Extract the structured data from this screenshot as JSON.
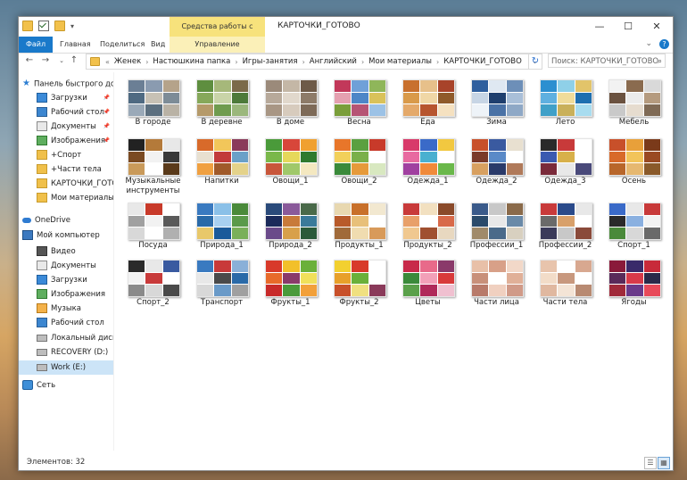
{
  "window": {
    "title": "КАРТОЧКИ_ГОТОВО",
    "picture_tools_tab": "Средства работы с рисунками",
    "controls": {
      "minimize": "—",
      "maximize": "☐",
      "close": "✕"
    }
  },
  "ribbon": {
    "tabs": [
      "Файл",
      "Главная",
      "Поделиться",
      "Вид"
    ],
    "manage_tab": "Управление",
    "collapse_icon": "⌄",
    "help_icon": "?"
  },
  "address": {
    "prefix": "«",
    "segments": [
      "Женек",
      "Настюшкина папка",
      "Игры-занятия",
      "Английский",
      "Мои материалы",
      "КАРТОЧКИ_ГОТОВО"
    ],
    "dropdown": "⌄",
    "refresh": "↻",
    "search_placeholder": "Поиск: КАРТОЧКИ_ГОТОВО",
    "search_icon": "⌕"
  },
  "sidebar": {
    "items": [
      {
        "label": "Панель быстрого доступа",
        "icon": "star-icon"
      },
      {
        "label": "Загрузки",
        "icon": "downloads-icon",
        "pinned": true
      },
      {
        "label": "Рабочий стол",
        "icon": "desktop-icon",
        "pinned": true
      },
      {
        "label": "Документы",
        "icon": "documents-icon",
        "pinned": true
      },
      {
        "label": "Изображения",
        "icon": "pictures-icon",
        "pinned": true
      },
      {
        "label": "+Спорт",
        "icon": "folder-icon"
      },
      {
        "label": "+Части тела",
        "icon": "folder-icon"
      },
      {
        "label": "КАРТОЧКИ_ГОТОВО",
        "icon": "folder-icon"
      },
      {
        "label": "Мои материалы",
        "icon": "folder-icon"
      },
      {
        "label": "OneDrive",
        "icon": "onedrive-icon"
      },
      {
        "label": "Мой компьютер",
        "icon": "computer-icon"
      },
      {
        "label": "Видео",
        "icon": "video-icon"
      },
      {
        "label": "Документы",
        "icon": "documents-icon"
      },
      {
        "label": "Загрузки",
        "icon": "downloads-icon"
      },
      {
        "label": "Изображения",
        "icon": "pictures-icon"
      },
      {
        "label": "Музыка",
        "icon": "music-icon"
      },
      {
        "label": "Рабочий стол",
        "icon": "desktop-icon"
      },
      {
        "label": "Локальный диск (C:)",
        "icon": "drive-icon"
      },
      {
        "label": "RECOVERY (D:)",
        "icon": "drive-icon"
      },
      {
        "label": "Work (E:)",
        "icon": "drive-icon",
        "selected": true
      },
      {
        "label": "Сеть",
        "icon": "network-icon"
      }
    ]
  },
  "folders": [
    {
      "name": "В городе",
      "colors": [
        "#6b7f95",
        "#8a9bb0",
        "#b5a38a",
        "#4f6a82",
        "#c7c1b5",
        "#7d8c97",
        "#9aa9b8",
        "#5c6f7f",
        "#b9b2a5"
      ]
    },
    {
      "name": "В деревне",
      "colors": [
        "#5e8e3f",
        "#a6b87a",
        "#7b6a4a",
        "#86a85a",
        "#c9d4a8",
        "#4d7a3a",
        "#b59a6a",
        "#6f9b4e",
        "#9bb77c"
      ]
    },
    {
      "name": "В доме",
      "colors": [
        "#9b8a7a",
        "#c4b7a6",
        "#6d5a48",
        "#b7a99a",
        "#e1d8cc",
        "#8d7b69",
        "#a89684",
        "#d7cbbd",
        "#7d6a58"
      ]
    },
    {
      "name": "Весна",
      "colors": [
        "#c2385a",
        "#6fa0d8",
        "#8fb65a",
        "#e5a0b0",
        "#4d86c7",
        "#d9c25a",
        "#7a9e3a",
        "#b65474",
        "#9cc2e6"
      ]
    },
    {
      "name": "Еда",
      "colors": [
        "#c8702e",
        "#e7c08a",
        "#a8432a",
        "#d99a4a",
        "#f0d7a6",
        "#8f5a2a",
        "#e4a96a",
        "#b7552f",
        "#f5e1c0"
      ]
    },
    {
      "name": "Зима",
      "colors": [
        "#2f5f9e",
        "#dfe8f2",
        "#6d8fb8",
        "#c7d5e5",
        "#1f3f6e",
        "#a9bfd8",
        "#eef3f8",
        "#4a72a6",
        "#8ea8c6"
      ]
    },
    {
      "name": "Лето",
      "colors": [
        "#2c8fd0",
        "#8fd0e8",
        "#e2c46a",
        "#5fb0e0",
        "#f0dc9a",
        "#1e6fb0",
        "#3fa0c8",
        "#c9b05a",
        "#a8dcef"
      ]
    },
    {
      "name": "Мебель",
      "colors": [
        "#f2f2f2",
        "#8a6b4f",
        "#d9d9d9",
        "#6b5240",
        "#ececec",
        "#b59b7f",
        "#c9c9c9",
        "#e6dccf",
        "#7f6a55"
      ]
    },
    {
      "name": "Музыкальные инструменты",
      "colors": [
        "#222222",
        "#b47a3a",
        "#e8e8e8",
        "#7a4a22",
        "#f2f2f2",
        "#3a3a3a",
        "#c99a5a",
        "#ffffff",
        "#5a3a1a"
      ]
    },
    {
      "name": "Напитки",
      "colors": [
        "#d86a2a",
        "#f2c65a",
        "#8a3a5a",
        "#e8e0d0",
        "#c23a3a",
        "#6aa0c8",
        "#f0a040",
        "#a05a2a",
        "#e4d28a"
      ]
    },
    {
      "name": "Овощи_1",
      "colors": [
        "#4a9a3a",
        "#d8463a",
        "#f0a030",
        "#7ab84a",
        "#e6d85a",
        "#2f7a2f",
        "#c8563a",
        "#a0c86a",
        "#f4e8c0"
      ]
    },
    {
      "name": "Овощи_2",
      "colors": [
        "#e8762a",
        "#5aa040",
        "#c83a2a",
        "#f2d05a",
        "#7ab04a",
        "#ffffff",
        "#3a8a3a",
        "#e69a3a",
        "#d8e8c0"
      ]
    },
    {
      "name": "Одежда_1",
      "colors": [
        "#d83a6a",
        "#3a6ac8",
        "#f2c840",
        "#e86aa0",
        "#4ab0d0",
        "#ffffff",
        "#a040a0",
        "#f08a3a",
        "#6ab84a"
      ]
    },
    {
      "name": "Одежда_2",
      "colors": [
        "#c8502a",
        "#3a5aa0",
        "#e8e0d0",
        "#7a3a2a",
        "#5a8ac8",
        "#ffffff",
        "#d8a060",
        "#2a3a6a",
        "#b07a5a"
      ]
    },
    {
      "name": "Одежда_3",
      "colors": [
        "#2a2a2a",
        "#c83a3a",
        "#ffffff",
        "#3a5ab0",
        "#d8b04a",
        "#ffffff",
        "#7a2a3a",
        "#e8e8e8",
        "#4a4a7a"
      ]
    },
    {
      "name": "Осень",
      "colors": [
        "#c8502a",
        "#e8a03a",
        "#7a3a1a",
        "#d86a2a",
        "#f2c45a",
        "#9a4a22",
        "#b8662a",
        "#e6b870",
        "#8a5a2a"
      ]
    },
    {
      "name": "Посуда",
      "colors": [
        "#e8e8e8",
        "#c83a2a",
        "#ffffff",
        "#a0a0a0",
        "#f2f2f2",
        "#5a5a5a",
        "#d8d8d8",
        "#ffffff",
        "#b0b0b0"
      ]
    },
    {
      "name": "Природа_1",
      "colors": [
        "#3a7ac0",
        "#8ac0e8",
        "#4a8a3a",
        "#2a6aa8",
        "#a8d0f0",
        "#5a9a4a",
        "#e8c86a",
        "#1a5a9a",
        "#7ab05a"
      ]
    },
    {
      "name": "Природа_2",
      "colors": [
        "#2a4a7a",
        "#8a5a9a",
        "#4a6a4a",
        "#1a2a5a",
        "#c87a3a",
        "#3a7a9a",
        "#6a4a8a",
        "#d8a04a",
        "#2a5a3a"
      ]
    },
    {
      "name": "Продукты_1",
      "colors": [
        "#e8d8b0",
        "#c8702a",
        "#f2e8d0",
        "#b85a2a",
        "#e8c07a",
        "#ffffff",
        "#a06a3a",
        "#f0dcb0",
        "#d89a5a"
      ]
    },
    {
      "name": "Продукты_2",
      "colors": [
        "#c83a3a",
        "#f2e0c0",
        "#8a4a2a",
        "#e8a06a",
        "#ffffff",
        "#d86a4a",
        "#f0c890",
        "#a05030",
        "#e8d8c0"
      ]
    },
    {
      "name": "Профессии_1",
      "colors": [
        "#3a5a8a",
        "#c8c8c8",
        "#8a6a4a",
        "#2a4a6a",
        "#e8e8e8",
        "#6a8aa8",
        "#a08a6a",
        "#4a6a8a",
        "#d8d0c0"
      ]
    },
    {
      "name": "Профессии_2",
      "colors": [
        "#c83a3a",
        "#2a4a8a",
        "#e8e8e8",
        "#6a6a6a",
        "#d8a06a",
        "#ffffff",
        "#3a3a5a",
        "#c8c8c8",
        "#8a4a3a"
      ]
    },
    {
      "name": "Спорт_1",
      "colors": [
        "#3a6ac8",
        "#e8e8e8",
        "#c83a3a",
        "#2a2a2a",
        "#8ab0e0",
        "#f2f2f2",
        "#4a8a3a",
        "#d8d8d8",
        "#6a6a6a"
      ]
    },
    {
      "name": "Спорт_2",
      "colors": [
        "#2a2a2a",
        "#e8e8e8",
        "#3a5aa0",
        "#f2f2f2",
        "#c83a3a",
        "#ffffff",
        "#8a8a8a",
        "#d8d8d8",
        "#4a4a4a"
      ]
    },
    {
      "name": "Транспорт",
      "colors": [
        "#3a7ac0",
        "#c83a3a",
        "#8ab0d8",
        "#e8e8e8",
        "#4a4a4a",
        "#2a6aa8",
        "#d8d8d8",
        "#6a9ac8",
        "#a0a0a0"
      ]
    },
    {
      "name": "Фрукты_1",
      "colors": [
        "#d83a2a",
        "#f2c02a",
        "#6ab03a",
        "#e86a2a",
        "#8a3a6a",
        "#f0e05a",
        "#c82a2a",
        "#4a9a3a",
        "#f2a03a"
      ]
    },
    {
      "name": "Фрукты_2",
      "colors": [
        "#f2d030",
        "#d83a2a",
        "#ffffff",
        "#e8a02a",
        "#6ab03a",
        "#ffffff",
        "#c8502a",
        "#f0e080",
        "#8a3a5a"
      ]
    },
    {
      "name": "Цветы",
      "colors": [
        "#c82a4a",
        "#e86a8a",
        "#8a3a6a",
        "#3a8a3a",
        "#f2a0b8",
        "#d83a3a",
        "#5aa04a",
        "#b02a5a",
        "#f0c0d0"
      ]
    },
    {
      "name": "Части лица",
      "colors": [
        "#e8c0a8",
        "#d8a088",
        "#f2d8c8",
        "#c8907a",
        "#ffffff",
        "#e0b098",
        "#b87a6a",
        "#f0d0c0",
        "#d09a88"
      ]
    },
    {
      "name": "Части тела",
      "colors": [
        "#e8c4ac",
        "#ffffff",
        "#d8a890",
        "#f2dcc8",
        "#c8987e",
        "#ffffff",
        "#e0b8a0",
        "#f4e4d6",
        "#b88a72"
      ]
    },
    {
      "name": "Ягоды",
      "colors": [
        "#8a1a3a",
        "#3a2a6a",
        "#c82a3a",
        "#5a2a5a",
        "#d83a4a",
        "#2a2a4a",
        "#a02a3a",
        "#6a3a8a",
        "#e84a5a"
      ]
    }
  ],
  "status": {
    "count": "Элементов: 32",
    "details_view_icon": "☰",
    "thumbnail_view_icon": "▦"
  }
}
